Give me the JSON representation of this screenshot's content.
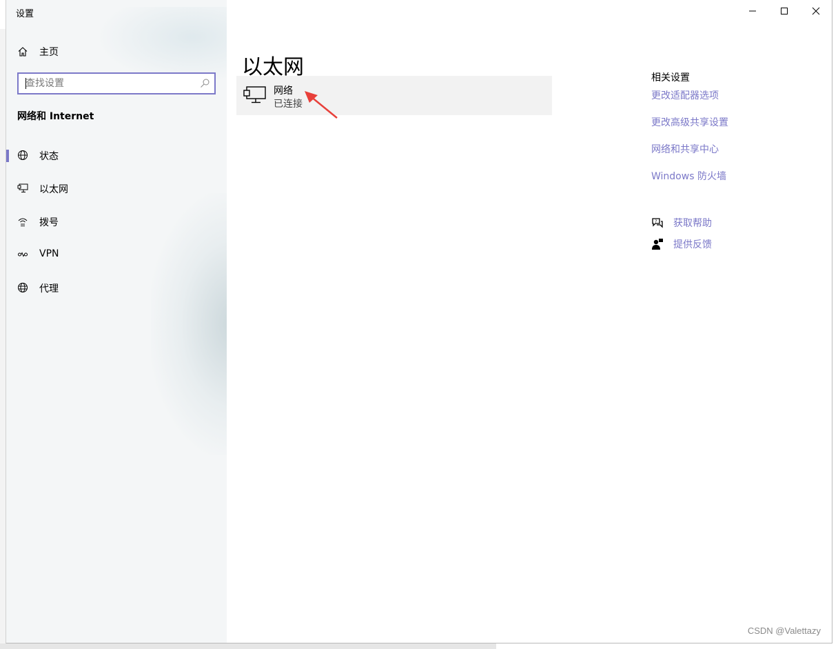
{
  "app": {
    "title": "设置"
  },
  "window_controls": {
    "minimize_icon": "minimize-icon",
    "maximize_icon": "maximize-icon",
    "close_icon": "close-icon"
  },
  "sidebar": {
    "home_label": "主页",
    "search": {
      "placeholder": "查找设置",
      "value": ""
    },
    "section_heading": "网络和 Internet",
    "items": [
      {
        "label": "状态",
        "icon": "globe-status-icon",
        "selected": true
      },
      {
        "label": "以太网",
        "icon": "ethernet-icon",
        "selected": false
      },
      {
        "label": "拨号",
        "icon": "dialup-icon",
        "selected": false
      },
      {
        "label": "VPN",
        "icon": "vpn-icon",
        "selected": false
      },
      {
        "label": "代理",
        "icon": "proxy-globe-icon",
        "selected": false
      }
    ]
  },
  "main": {
    "page_title": "以太网",
    "network": {
      "name": "网络",
      "status": "已连接",
      "icon": "ethernet-monitor-icon"
    },
    "related": {
      "heading": "相关设置",
      "links": [
        "更改适配器选项",
        "更改高级共享设置",
        "网络和共享中心",
        "Windows 防火墙"
      ]
    },
    "help": [
      {
        "label": "获取帮助",
        "icon": "help-chat-icon"
      },
      {
        "label": "提供反馈",
        "icon": "feedback-person-icon"
      }
    ]
  },
  "overlay": {
    "watermark": "CSDN @Valettazy"
  },
  "colors": {
    "accent": "#7b78c8",
    "sidebar_bg": "#f4f6f7",
    "card_bg": "#f2f2f2",
    "arrow": "#e8403a"
  }
}
